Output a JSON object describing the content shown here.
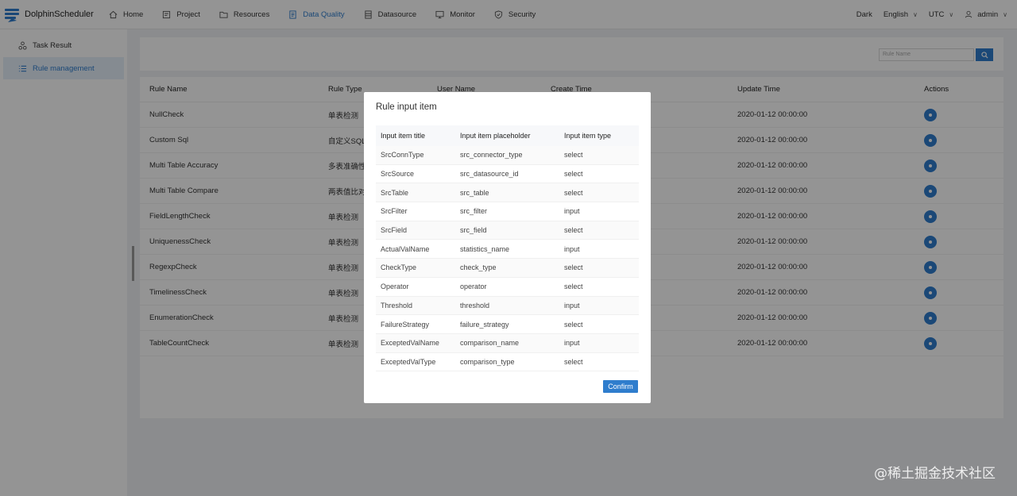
{
  "app": {
    "name": "DolphinScheduler"
  },
  "nav": {
    "items": [
      {
        "label": "Home",
        "icon": "home-icon"
      },
      {
        "label": "Project",
        "icon": "project-icon"
      },
      {
        "label": "Resources",
        "icon": "folder-icon"
      },
      {
        "label": "Data Quality",
        "icon": "document-icon"
      },
      {
        "label": "Datasource",
        "icon": "database-icon"
      },
      {
        "label": "Monitor",
        "icon": "monitor-icon"
      },
      {
        "label": "Security",
        "icon": "shield-icon"
      }
    ],
    "active": "Data Quality",
    "theme": "Dark",
    "language": "English",
    "timezone": "UTC",
    "user": "admin"
  },
  "sidebar": {
    "items": [
      {
        "label": "Task Result",
        "icon": "task-result-icon"
      },
      {
        "label": "Rule management",
        "icon": "list-icon"
      }
    ],
    "active": "Rule management"
  },
  "search": {
    "placeholder": "Rule Name"
  },
  "table": {
    "headers": [
      "Rule Name",
      "Rule Type",
      "User Name",
      "Create Time",
      "Update Time",
      "Actions"
    ],
    "rows": [
      {
        "name": "NullCheck",
        "type": "单表检测",
        "update": "2020-01-12 00:00:00"
      },
      {
        "name": "Custom Sql",
        "type": "自定义SQL",
        "update": "2020-01-12 00:00:00"
      },
      {
        "name": "Multi Table Accuracy",
        "type": "多表准确性",
        "update": "2020-01-12 00:00:00"
      },
      {
        "name": "Multi Table Compare",
        "type": "两表值比对",
        "update": "2020-01-12 00:00:00"
      },
      {
        "name": "FieldLengthCheck",
        "type": "单表检测",
        "update": "2020-01-12 00:00:00"
      },
      {
        "name": "UniquenessCheck",
        "type": "单表检测",
        "update": "2020-01-12 00:00:00"
      },
      {
        "name": "RegexpCheck",
        "type": "单表检测",
        "update": "2020-01-12 00:00:00"
      },
      {
        "name": "TimelinessCheck",
        "type": "单表检测",
        "update": "2020-01-12 00:00:00"
      },
      {
        "name": "EnumerationCheck",
        "type": "单表检测",
        "update": "2020-01-12 00:00:00"
      },
      {
        "name": "TableCountCheck",
        "type": "单表检测",
        "update": "2020-01-12 00:00:00"
      }
    ]
  },
  "modal": {
    "title": "Rule input item",
    "headers": [
      "Input item title",
      "Input item placeholder",
      "Input item type"
    ],
    "rows": [
      [
        "SrcConnType",
        "src_connector_type",
        "select"
      ],
      [
        "SrcSource",
        "src_datasource_id",
        "select"
      ],
      [
        "SrcTable",
        "src_table",
        "select"
      ],
      [
        "SrcFilter",
        "src_filter",
        "input"
      ],
      [
        "SrcField",
        "src_field",
        "select"
      ],
      [
        "ActualValName",
        "statistics_name",
        "input"
      ],
      [
        "CheckType",
        "check_type",
        "select"
      ],
      [
        "Operator",
        "operator",
        "select"
      ],
      [
        "Threshold",
        "threshold",
        "input"
      ],
      [
        "FailureStrategy",
        "failure_strategy",
        "select"
      ],
      [
        "ExceptedValName",
        "comparison_name",
        "input"
      ],
      [
        "ExceptedValType",
        "comparison_type",
        "select"
      ]
    ],
    "confirm_label": "Confirm"
  },
  "watermark": "@稀土掘金技术社区",
  "colors": {
    "accent": "#2f7dcd",
    "overlay": "rgba(0,0,0,0.42)"
  }
}
